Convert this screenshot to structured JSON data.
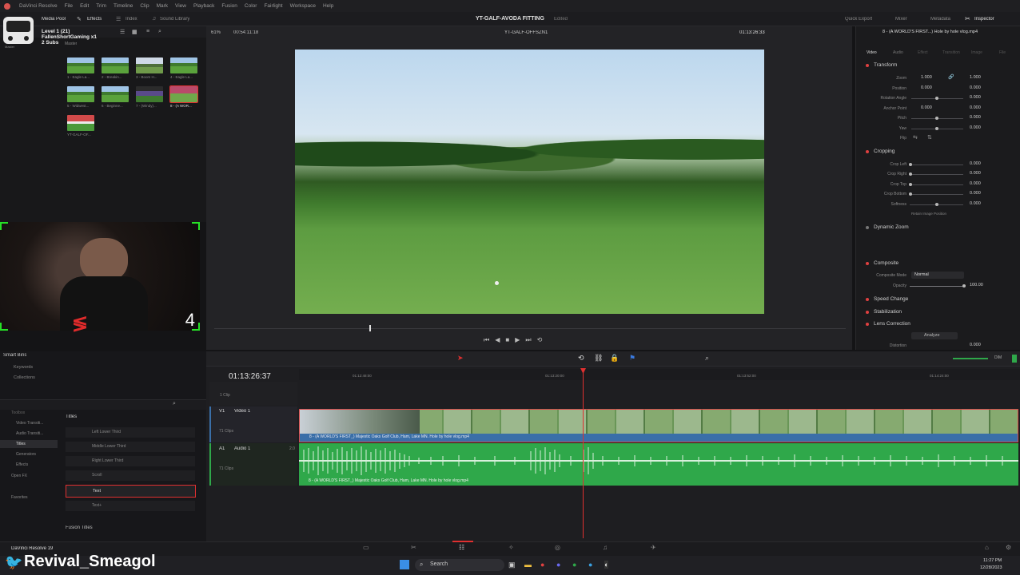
{
  "menu": [
    "DaVinci Resolve",
    "File",
    "Edit",
    "Trim",
    "Timeline",
    "Clip",
    "Mark",
    "View",
    "Playback",
    "Fusion",
    "Color",
    "Fairlight",
    "Workspace",
    "Help"
  ],
  "toolbar": {
    "left_tabs": [
      "Media Pool",
      "Effects",
      "Index",
      "Sound Library"
    ],
    "project_title": "YT-GALF-AVODA FITTING",
    "project_status": "Edited",
    "right_tabs": [
      "Quick Export",
      "Mixer",
      "Metadata",
      "Inspector"
    ]
  },
  "mediapool": {
    "bin": "Master",
    "clips": [
      "1 - Eagle La...",
      "2 - Breakin...",
      "3 - Boom H...",
      "4 - Eagle La...",
      "5 - Widwest...",
      "6 - Beginne...",
      "7 - (Windy)...",
      "8 - (A WOR...",
      "YT-GALF-OF..."
    ]
  },
  "overlay": {
    "title": "Level 1 (21)",
    "name": "FallenShortGaming x1",
    "subs": "2 Subs",
    "badge": "Master"
  },
  "webcam": {
    "counter": "4"
  },
  "viewer": {
    "zoom": "61%",
    "source_tc": "00:54:11:18",
    "timeline_name": "YT-GALF-OFFSZN1",
    "record_tc": "01:13:26:33"
  },
  "inspector": {
    "clip_title": "8 - (A WORLD'S FIRST...) Hole by hole vlog.mp4",
    "tabs": [
      "Video",
      "Audio",
      "Effect",
      "Transition",
      "Image",
      "File"
    ],
    "transform": {
      "label": "Transform",
      "zoom_label": "Zoom",
      "zoom_x": "1.000",
      "zoom_y": "1.000",
      "position_label": "Position",
      "pos_x": "0.000",
      "pos_y": "0.000",
      "rotation_label": "Rotation Angle",
      "rotation": "0.000",
      "anchor_label": "Anchor Point",
      "anchor_x": "0.000",
      "anchor_y": "0.000",
      "pitch_label": "Pitch",
      "pitch": "0.000",
      "yaw_label": "Yaw",
      "yaw": "0.000",
      "flip_label": "Flip"
    },
    "cropping": {
      "label": "Cropping",
      "left_label": "Crop Left",
      "left": "0.000",
      "right_label": "Crop Right",
      "right": "0.000",
      "top_label": "Crop Top",
      "top": "0.000",
      "bottom_label": "Crop Bottom",
      "bottom": "0.000",
      "soft_label": "Softness",
      "soft": "0.000",
      "retain": "Retain Image Position"
    },
    "dynamic_zoom": "Dynamic Zoom",
    "composite": {
      "label": "Composite",
      "mode_label": "Composite Mode",
      "mode": "Normal",
      "opacity_label": "Opacity",
      "opacity": "100.00"
    },
    "speed": "Speed Change",
    "stabilization": "Stabilization",
    "lens": "Lens Correction",
    "analyze": "Analyze",
    "distortion_label": "Distortion",
    "distortion": "0.000"
  },
  "effects": {
    "tree": [
      "Toolbox",
      "Video Transiti...",
      "Audio Transiti...",
      "Titles",
      "Generators",
      "Effects",
      "Open FX",
      "Favorites"
    ],
    "smart_bins": "Smart Bins",
    "keywords": "Keywords",
    "collections": "Collections",
    "section": "Titles",
    "items": [
      "Left Lower Third",
      "Middle Lower Third",
      "Right Lower Third",
      "Scroll",
      "Text",
      "Text+"
    ],
    "fusion": "Fusion Titles"
  },
  "timeline": {
    "timecode": "01:13:26:37",
    "ruler": [
      "01:12:48:00",
      "01:13:20:00",
      "01:13:52:00",
      "01:14:24:00"
    ],
    "v1": "Video 1",
    "v1_tag": "V1",
    "v1_clips": "71 Clips",
    "a1": "Audio 1",
    "a1_tag": "A1",
    "a1_level": "2.0",
    "a1_clips": "71 Clips",
    "vclip_name": "8 - (A WORLD'S FIRST_) Majestic Oaks Golf Club, Ham, Lake MN. Hole by hole vlog.mp4",
    "aclip_name": "8 - (A WORLD'S FIRST_) Majestic Oaks Golf Club, Ham, Lake MN. Hole by hole vlog.mp4",
    "top_clip": "1 Clip",
    "meter": "DIM"
  },
  "footer": {
    "app": "DaVinci Resolve 19",
    "twitter": "Revival_Smeagol"
  },
  "taskbar": {
    "search": "Search",
    "time": "11:27 PM",
    "date": "12/28/2023"
  },
  "colors": {
    "accent_red": "#e03030",
    "audio_green": "#2fa84a",
    "video_blue": "#3a6fa8",
    "cam_border": "#26e026"
  }
}
